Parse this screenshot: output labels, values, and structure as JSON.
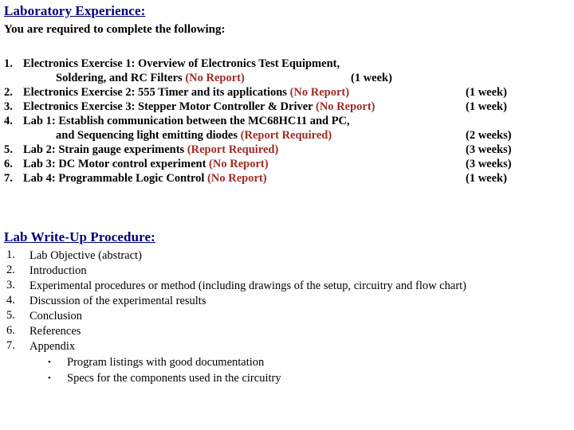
{
  "document": {
    "background_color": "#ffffff",
    "heading_color": "#00007a",
    "report_tag_color": "#9e2b25",
    "body_color": "#000000"
  },
  "lab_experience": {
    "heading": "Laboratory Experience:",
    "subtitle": "You are required to complete the following:",
    "items": [
      {
        "number": "1.",
        "line1": "Electronics Exercise 1: Overview of Electronics Test Equipment,",
        "line2_text": "Soldering, and RC Filters ",
        "line2_report": "(No Report)",
        "duration": "(1 week)",
        "duration_position": "inline"
      },
      {
        "number": "2.",
        "text": "Electronics Exercise 2: 555 Timer and its applications ",
        "report": "(No Report)",
        "duration": "(1 week)"
      },
      {
        "number": "3.",
        "text": "Electronics Exercise 3: Stepper Motor Controller & Driver ",
        "report": "(No Report)",
        "duration": "(1 week)"
      },
      {
        "number": "4.",
        "line1": "Lab 1: Establish communication between the MC68HC11 and PC,",
        "line2_text": "and Sequencing light emitting diodes ",
        "line2_report": "(Report Required)",
        "duration": "(2 weeks)",
        "duration_position": "column"
      },
      {
        "number": "5.",
        "text": "Lab 2: Strain gauge experiments ",
        "report": "(Report Required)",
        "duration": "(3 weeks)"
      },
      {
        "number": "6.",
        "text": "Lab 3: DC Motor control experiment ",
        "report": "(No Report)",
        "duration": "(3 weeks)"
      },
      {
        "number": "7.",
        "text": "Lab 4: Programmable Logic Control ",
        "report": "(No Report)",
        "duration": "(1 week)"
      }
    ]
  },
  "writeup_procedure": {
    "heading": "Lab Write-Up Procedure:",
    "items": [
      {
        "number": "1.",
        "text": "Lab Objective (abstract)"
      },
      {
        "number": "2.",
        "text": "Introduction"
      },
      {
        "number": "3.",
        "text": "Experimental procedures or method (including drawings of the setup, circuitry and flow chart)"
      },
      {
        "number": "4.",
        "text": "Discussion of the experimental results"
      },
      {
        "number": "5.",
        "text": "Conclusion"
      },
      {
        "number": "6.",
        "text": "References"
      },
      {
        "number": "7.",
        "text": "Appendix"
      }
    ],
    "appendix_bullets": [
      {
        "marker": "•",
        "text": "Program listings with good documentation"
      },
      {
        "marker": "•",
        "text": "Specs for the components used in the circuitry"
      }
    ]
  }
}
